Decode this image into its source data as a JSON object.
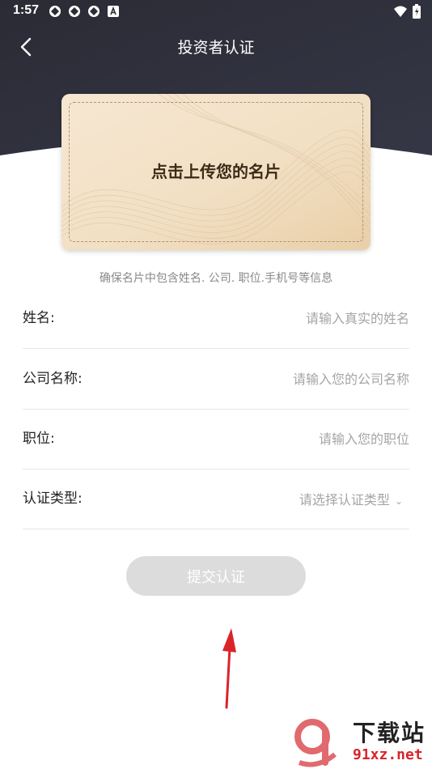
{
  "status_bar": {
    "time": "1:57"
  },
  "header": {
    "title": "投资者认证"
  },
  "upload_card": {
    "text": "点击上传您的名片"
  },
  "hint": "确保名片中包含姓名. 公司. 职位.手机号等信息",
  "form": {
    "name": {
      "label": "姓名:",
      "placeholder": "请输入真实的姓名"
    },
    "company": {
      "label": "公司名称:",
      "placeholder": "请输入您的公司名称"
    },
    "position": {
      "label": "职位:",
      "placeholder": "请输入您的职位"
    },
    "cert_type": {
      "label": "认证类型:",
      "placeholder": "请选择认证类型"
    }
  },
  "submit_label": "提交认证",
  "watermark": {
    "brand": "下载站",
    "site": "91xz.net"
  },
  "colors": {
    "header": "#2c2d38",
    "card": "#f0dcc0",
    "submit_disabled": "#dcdcdc",
    "arrow": "#d9242a"
  }
}
